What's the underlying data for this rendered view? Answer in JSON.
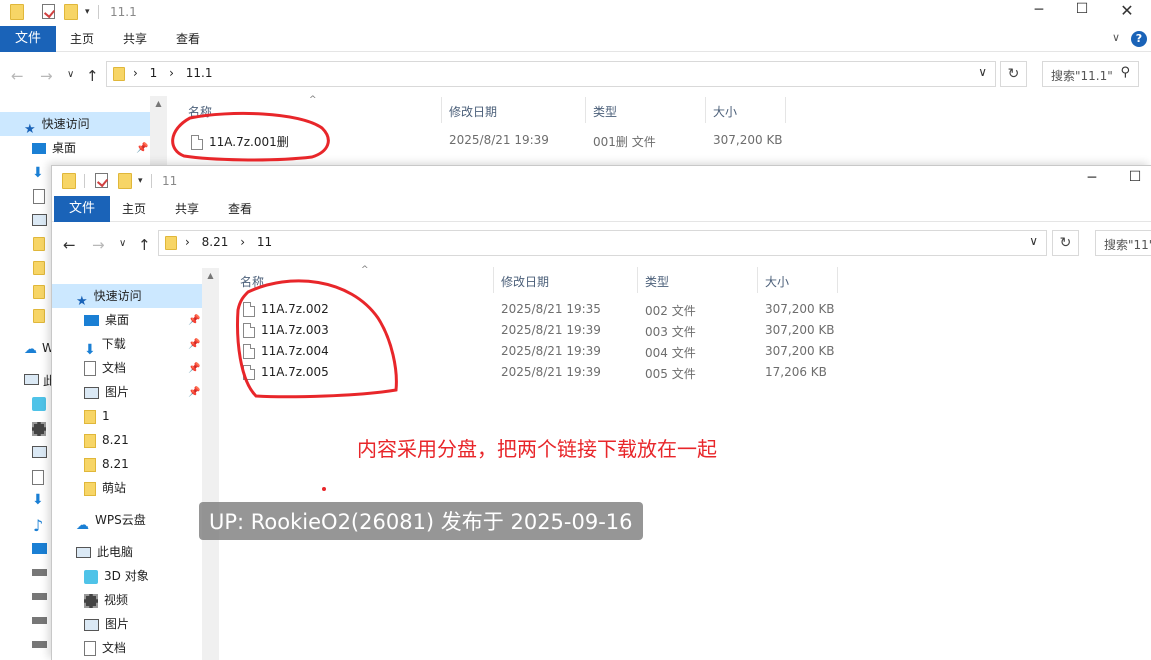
{
  "back_window": {
    "title": "11.1",
    "tabs": {
      "file": "文件",
      "home": "主页",
      "share": "共享",
      "view": "查看"
    },
    "breadcrumb": [
      "1",
      "11.1"
    ],
    "search_placeholder": "搜索\"11.1\"",
    "columns": {
      "name": "名称",
      "date": "修改日期",
      "type": "类型",
      "size": "大小"
    },
    "sidebar": {
      "quick_access": "快速访问",
      "desktop": "桌面"
    },
    "files": [
      {
        "name": "11A.7z.001删",
        "date": "2025/8/21 19:39",
        "type": "001删 文件",
        "size": "307,200 KB"
      }
    ]
  },
  "front_window": {
    "title": "11",
    "tabs": {
      "file": "文件",
      "home": "主页",
      "share": "共享",
      "view": "查看"
    },
    "breadcrumb": [
      "8.21",
      "11"
    ],
    "search_placeholder": "搜索\"11\"",
    "columns": {
      "name": "名称",
      "date": "修改日期",
      "type": "类型",
      "size": "大小"
    },
    "sidebar": [
      {
        "label": "快速访问",
        "icon": "star-icon"
      },
      {
        "label": "桌面",
        "icon": "desktop-icon",
        "pinned": true
      },
      {
        "label": "下载",
        "icon": "download-icon",
        "pinned": true
      },
      {
        "label": "文档",
        "icon": "document-icon",
        "pinned": true
      },
      {
        "label": "图片",
        "icon": "picture-icon",
        "pinned": true
      },
      {
        "label": "1",
        "icon": "folder-icon"
      },
      {
        "label": "8.21",
        "icon": "folder-icon"
      },
      {
        "label": "8.21",
        "icon": "folder-icon"
      },
      {
        "label": "萌站",
        "icon": "folder-icon"
      },
      {
        "label": "WPS云盘",
        "icon": "cloud-icon"
      },
      {
        "label": "此电脑",
        "icon": "computer-icon"
      },
      {
        "label": "3D 对象",
        "icon": "cube-icon"
      },
      {
        "label": "视频",
        "icon": "video-icon"
      },
      {
        "label": "图片",
        "icon": "picture-icon"
      },
      {
        "label": "文档",
        "icon": "document-icon"
      }
    ],
    "files": [
      {
        "name": "11A.7z.002",
        "date": "2025/8/21 19:35",
        "type": "002 文件",
        "size": "307,200 KB"
      },
      {
        "name": "11A.7z.003",
        "date": "2025/8/21 19:39",
        "type": "003 文件",
        "size": "307,200 KB"
      },
      {
        "name": "11A.7z.004",
        "date": "2025/8/21 19:39",
        "type": "004 文件",
        "size": "307,200 KB"
      },
      {
        "name": "11A.7z.005",
        "date": "2025/8/21 19:39",
        "type": "005 文件",
        "size": "17,206 KB"
      }
    ]
  },
  "back_sidebar_partial": {
    "wps": "W",
    "pc": "此"
  },
  "annotation": "内容采用分盘，把两个链接下载放在一起",
  "watermark": "UP: RookieO2(26081) 发布于 2025-09-16",
  "colors": {
    "accent": "#1a63b8",
    "annotation": "#e8262a",
    "selection": "#cce8ff"
  }
}
